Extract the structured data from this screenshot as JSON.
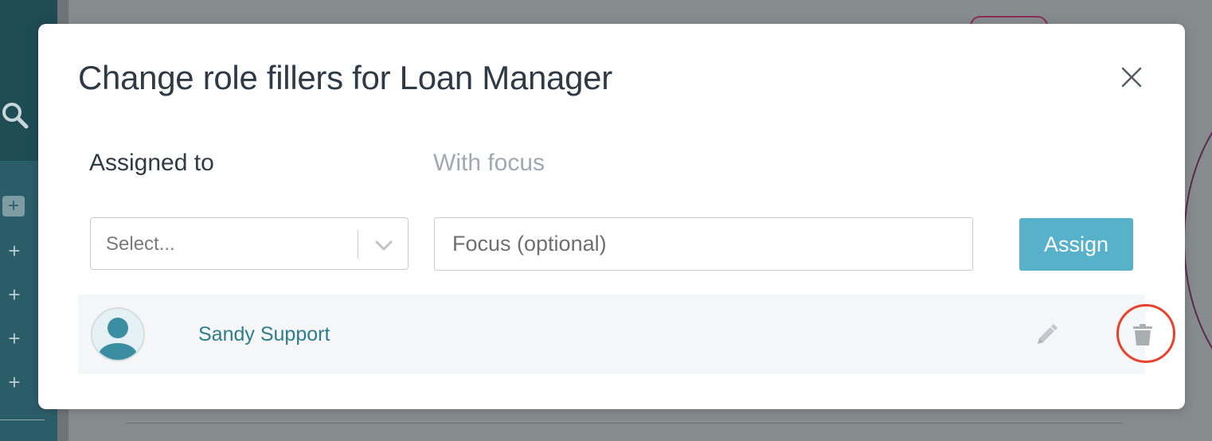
{
  "modal": {
    "title": "Change role fillers for Loan Manager",
    "close_icon": "close-icon"
  },
  "form": {
    "assigned_label": "Assigned to",
    "focus_label": "With focus",
    "select_placeholder": "Select...",
    "focus_placeholder": "Focus (optional)",
    "focus_value": "",
    "assign_button_label": "Assign"
  },
  "fillers": [
    {
      "name": "Sandy Support",
      "avatar_icon": "user-avatar-icon",
      "edit_icon": "pencil-icon",
      "delete_icon": "trash-icon"
    }
  ],
  "colors": {
    "accent": "#57b2c9",
    "link": "#2d7c8c",
    "highlight": "#e8412c"
  }
}
